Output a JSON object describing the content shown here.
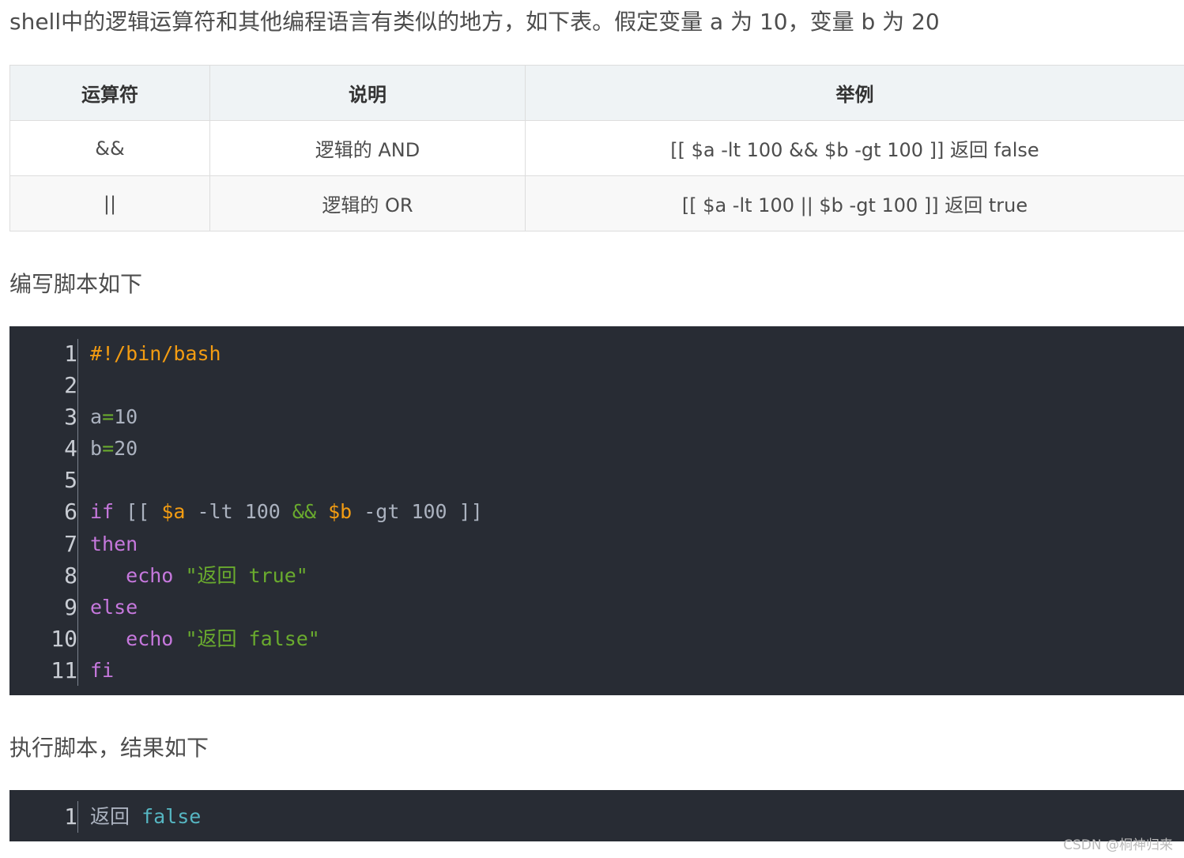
{
  "intro_text": "shell中的逻辑运算符和其他编程语言有类似的地方，如下表。假定变量 a 为 10，变量 b 为 20",
  "table": {
    "headers": [
      "运算符",
      "说明",
      "举例"
    ],
    "rows": [
      [
        "&&",
        "逻辑的 AND",
        "[[ $a -lt 100 && $b -gt 100 ]] 返回 false"
      ],
      [
        "||",
        "逻辑的 OR",
        "[[ $a -lt 100 || $b -gt 100 ]] 返回 true"
      ]
    ]
  },
  "script_heading": "编写脚本如下",
  "script_code": {
    "line_numbers": [
      "1",
      "2",
      "3",
      "4",
      "5",
      "6",
      "7",
      "8",
      "9",
      "10",
      "11"
    ],
    "lines": [
      [
        {
          "t": "#!/bin/bash",
          "c": "meta"
        }
      ],
      [],
      [
        {
          "t": "a",
          "c": "plain"
        },
        {
          "t": "=",
          "c": "op"
        },
        {
          "t": "10",
          "c": "plain"
        }
      ],
      [
        {
          "t": "b",
          "c": "plain"
        },
        {
          "t": "=",
          "c": "op"
        },
        {
          "t": "20",
          "c": "plain"
        }
      ],
      [],
      [
        {
          "t": "if",
          "c": "kw"
        },
        {
          "t": " [[ ",
          "c": "plain"
        },
        {
          "t": "$a",
          "c": "var"
        },
        {
          "t": " -lt 100 ",
          "c": "plain"
        },
        {
          "t": "&&",
          "c": "op"
        },
        {
          "t": " ",
          "c": "plain"
        },
        {
          "t": "$b",
          "c": "var"
        },
        {
          "t": " -gt 100 ]]",
          "c": "plain"
        }
      ],
      [
        {
          "t": "then",
          "c": "kw"
        }
      ],
      [
        {
          "t": "   ",
          "c": "plain"
        },
        {
          "t": "echo",
          "c": "kw"
        },
        {
          "t": " ",
          "c": "plain"
        },
        {
          "t": "\"返回 true\"",
          "c": "str"
        }
      ],
      [
        {
          "t": "else",
          "c": "kw"
        }
      ],
      [
        {
          "t": "   ",
          "c": "plain"
        },
        {
          "t": "echo",
          "c": "kw"
        },
        {
          "t": " ",
          "c": "plain"
        },
        {
          "t": "\"返回 false\"",
          "c": "str"
        }
      ],
      [
        {
          "t": "fi",
          "c": "kw"
        }
      ]
    ]
  },
  "run_heading": "执行脚本，结果如下",
  "output_code": {
    "line_numbers": [
      "1"
    ],
    "lines": [
      [
        {
          "t": "返回 ",
          "c": "cn"
        },
        {
          "t": "false",
          "c": "bool"
        }
      ]
    ]
  },
  "watermark": "CSDN @桐神归来"
}
